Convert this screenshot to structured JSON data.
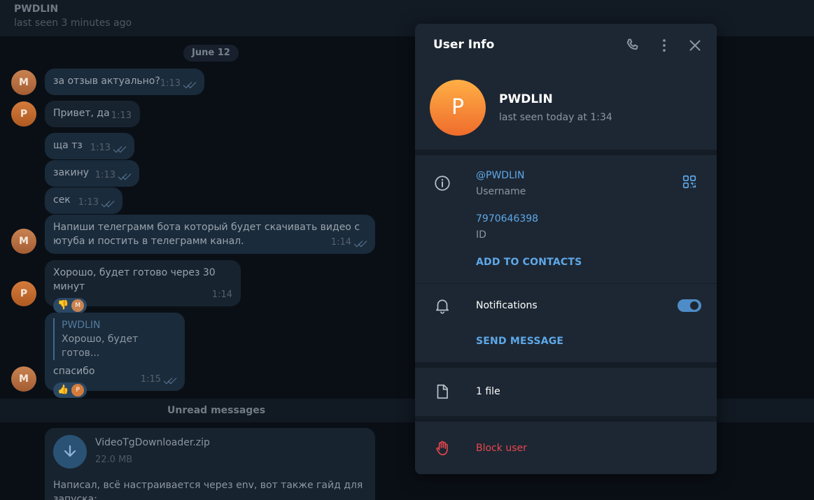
{
  "chat": {
    "contact_name": "PWDLIN",
    "contact_status": "last seen 3 minutes ago",
    "date_label": "June 12",
    "messages": [
      {
        "author": "M",
        "text": "за отзыв актуально?",
        "time": "1:13"
      },
      {
        "author": "P",
        "text": "Привет, да",
        "time": "1:13"
      },
      {
        "author": "M",
        "text": "ща тз",
        "time": "1:13"
      },
      {
        "author": "M",
        "text": "закину",
        "time": "1:13"
      },
      {
        "author": "M",
        "text": "сек",
        "time": "1:13"
      },
      {
        "author": "M",
        "text": "Напиши телеграмм бота который будет скачивать видео с ютуба и постить в телеграмм канал.",
        "time": "1:14"
      },
      {
        "author": "P",
        "text": "Хорошо, будет готово через 30 минут",
        "time": "1:14",
        "reaction": "👎",
        "reaction_by": "M"
      },
      {
        "author": "M",
        "reply_name": "PWDLIN",
        "reply_text": "Хорошо, будет готов...",
        "text": "спасибо",
        "time": "1:15",
        "reaction": "👍",
        "reaction_by": "P"
      }
    ],
    "unread_label": "Unread messages",
    "file": {
      "name": "VideoTgDownloader.zip",
      "size": "22.0 MB",
      "caption": "Написал, всё настраивается через env, вот также гайд для запуска:"
    }
  },
  "panel": {
    "title": "User Info",
    "name": "PWDLIN",
    "avatar_letter": "P",
    "status": "last seen today at 1:34",
    "username": "@PWDLIN",
    "username_label": "Username",
    "id_value": "7970646398",
    "id_label": "ID",
    "add_contacts": "ADD TO CONTACTS",
    "notifications_label": "Notifications",
    "notifications_on": true,
    "send_message": "SEND MESSAGE",
    "files_label": "1 file",
    "block_label": "Block user"
  },
  "colors": {
    "accent": "#5ea8e8",
    "danger": "#e8474c",
    "panel_bg": "#1d2733",
    "chat_bg": "#0a0f16"
  }
}
